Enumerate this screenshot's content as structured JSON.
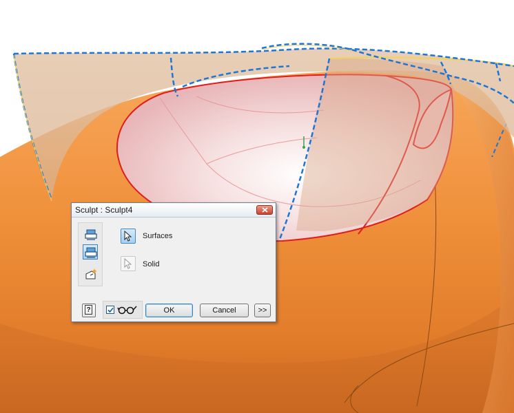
{
  "dialog": {
    "title": "Sculpt : Sculpt4",
    "options": [
      {
        "label": "Surfaces",
        "icon": "cursor-arrow-icon",
        "active": true
      },
      {
        "label": "Solid",
        "icon": "cursor-arrow-icon",
        "active": false
      }
    ],
    "tools": [
      "bodies-tool-icon",
      "solid-tool-icon",
      "side-operation-icon"
    ],
    "buttons": {
      "ok": "OK",
      "cancel": "Cancel",
      "more": ">>"
    },
    "preview_checked": true
  },
  "colors": {
    "model_orange": "#ef8f3a",
    "surface_tan": "#e7c8a8",
    "edge_red": "#e01d1d",
    "sketch_blue": "#1b76d8",
    "sketch_yellow": "#f2d25b"
  }
}
